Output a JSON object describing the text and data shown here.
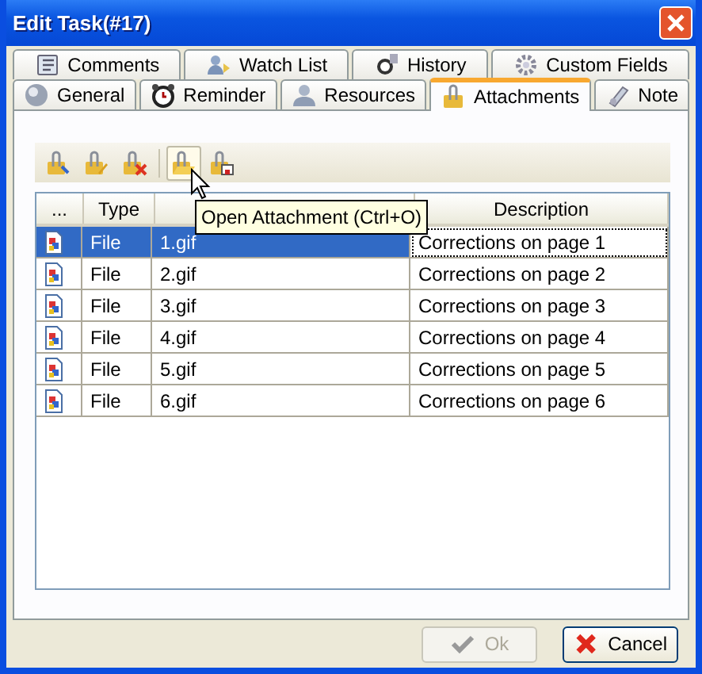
{
  "window": {
    "title": "Edit Task(#17)"
  },
  "tab_rows": [
    [
      {
        "label": "Comments",
        "kind": "comments",
        "selected": false
      },
      {
        "label": "Watch List",
        "kind": "watch",
        "selected": false
      },
      {
        "label": "History",
        "kind": "history",
        "selected": false
      },
      {
        "label": "Custom Fields",
        "kind": "gear",
        "selected": false
      }
    ],
    [
      {
        "label": "General",
        "kind": "ball",
        "selected": false
      },
      {
        "label": "Reminder",
        "kind": "clock",
        "selected": false
      },
      {
        "label": "Resources",
        "kind": "person",
        "selected": false
      },
      {
        "label": "Attachments",
        "kind": "attach",
        "selected": true
      },
      {
        "label": "Note",
        "kind": "note",
        "selected": false
      }
    ]
  ],
  "toolbar": [
    {
      "kind": "add",
      "hovered": false
    },
    {
      "kind": "edit",
      "hovered": false
    },
    {
      "kind": "delete",
      "hovered": false
    },
    {
      "kind": "open",
      "hovered": true
    },
    {
      "kind": "save",
      "hovered": false
    }
  ],
  "tooltip": "Open Attachment (Ctrl+O)",
  "table": {
    "columns": [
      {
        "kind": "icon",
        "label": "..."
      },
      {
        "kind": "type",
        "label": "Type"
      },
      {
        "kind": "name"
      },
      {
        "kind": "description",
        "label": "Description"
      }
    ],
    "rows": [
      {
        "type": "File",
        "name": "1.gif",
        "description": "Corrections on page 1",
        "selected": true
      },
      {
        "type": "File",
        "name": "2.gif",
        "description": "Corrections on page 2",
        "selected": false
      },
      {
        "type": "File",
        "name": "3.gif",
        "description": "Corrections on page 3",
        "selected": false
      },
      {
        "type": "File",
        "name": "4.gif",
        "description": "Corrections on page 4",
        "selected": false
      },
      {
        "type": "File",
        "name": "5.gif",
        "description": "Corrections on page 5",
        "selected": false
      },
      {
        "type": "File",
        "name": "6.gif",
        "description": "Corrections on page 6",
        "selected": false
      }
    ]
  },
  "buttons": [
    {
      "kind": "ok",
      "label": "Ok",
      "disabled": true
    },
    {
      "kind": "cancel",
      "label": "Cancel",
      "disabled": false
    }
  ]
}
